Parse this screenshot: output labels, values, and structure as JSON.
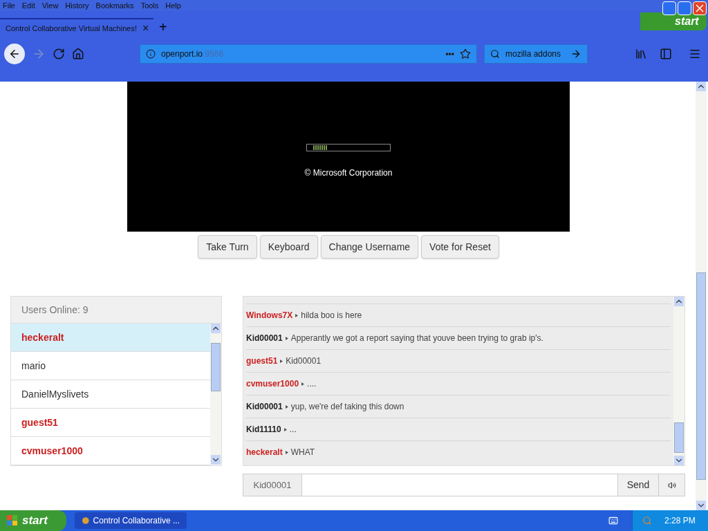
{
  "menu_bar": [
    "File",
    "Edit",
    "View",
    "History",
    "Bookmarks",
    "Tools",
    "Help"
  ],
  "overlay_start": "start",
  "browser_tab": {
    "title": "Control Collaborative Virtual Machines!",
    "close": "×",
    "new": "+"
  },
  "address_bar": {
    "host": "openport.io",
    "port": ":9566",
    "more": "•••"
  },
  "search_bar": {
    "value": "mozilla addons"
  },
  "vm_screen": {
    "caption": "© Microsoft Corporation"
  },
  "vm_buttons": [
    "Take Turn",
    "Keyboard",
    "Change Username",
    "Vote for Reset"
  ],
  "users": {
    "title": "Users Online: 9",
    "items": [
      {
        "name": "heckeralt",
        "color": "#cc1f1f",
        "selected": true
      },
      {
        "name": "mario",
        "color": "#333333",
        "selected": false
      },
      {
        "name": "DanielMyslivets",
        "color": "#333333",
        "selected": false
      },
      {
        "name": "guest51",
        "color": "#cc1f1f",
        "selected": false
      },
      {
        "name": "cvmuser1000",
        "color": "#cc1f1f",
        "selected": false
      }
    ]
  },
  "chat": {
    "messages": [
      {
        "user": "Windows7X",
        "color": "#cc1f1f",
        "text": "hilda boo is here"
      },
      {
        "user": "Kid00001",
        "color": "#222222",
        "text": "Apperantly we got a report saying that youve been trying to grab ip's."
      },
      {
        "user": "guest51",
        "color": "#cc1f1f",
        "text": "Kid00001"
      },
      {
        "user": "cvmuser1000",
        "color": "#cc1f1f",
        "text": "...."
      },
      {
        "user": "Kid00001",
        "color": "#222222",
        "text": "yup, we're def taking this down"
      },
      {
        "user": "Kid11110",
        "color": "#222222",
        "text": "..."
      },
      {
        "user": "heckeralt",
        "color": "#cc1f1f",
        "text": "WHAT"
      }
    ]
  },
  "chat_input": {
    "username": "Kid00001",
    "send": "Send"
  },
  "taskbar": {
    "start": "start",
    "task": "Control Collaborative ...",
    "clock": "2:28 PM"
  }
}
